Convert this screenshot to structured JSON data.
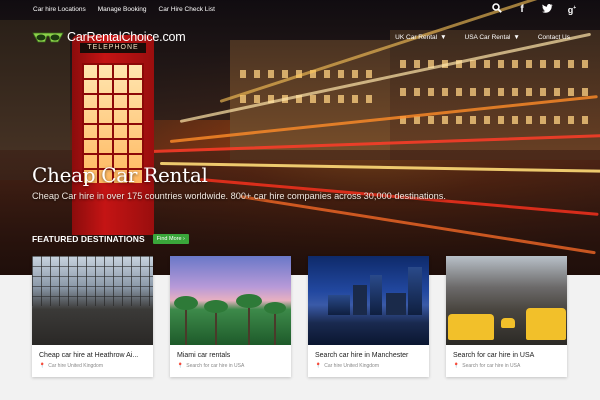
{
  "topbar": {
    "links": [
      "Car hire Locations",
      "Manage Booking",
      "Car Hire Check List"
    ],
    "social_icons": [
      "search-icon",
      "facebook-icon",
      "twitter-icon",
      "google-plus-icon"
    ]
  },
  "nav": {
    "logo_text": "CarRentalChoice.com",
    "menu": [
      {
        "label": "UK Car Rental",
        "has_dropdown": true
      },
      {
        "label": "USA Car Rental",
        "has_dropdown": true
      },
      {
        "label": "Contact Us",
        "has_dropdown": false
      }
    ]
  },
  "hero": {
    "title": "Cheap Car Rental",
    "subtitle": "Cheap Car hire in over 175 countries worldwide. 800+ car hire companies across 30,000 destinations.",
    "booth_sign": "TELEPHONE"
  },
  "featured": {
    "heading": "FEATURED DESTINATIONS",
    "find_more": "Find More ›"
  },
  "cards": [
    {
      "title": "Cheap car hire at Heathrow Ai...",
      "meta": "Car hire United Kingdom",
      "image": "heathrow"
    },
    {
      "title": "Miami car rentals",
      "meta": "Search for car hire in USA",
      "image": "miami"
    },
    {
      "title": "Search car hire in Manchester",
      "meta": "Car hire United Kingdom",
      "image": "manchester"
    },
    {
      "title": "Search for car hire in USA",
      "meta": "Search for car hire in USA",
      "image": "usa"
    }
  ],
  "colors": {
    "find_more_bg": "#3aa63a",
    "logo_icon": "#8bd24a",
    "booth_red": "#c41414"
  }
}
